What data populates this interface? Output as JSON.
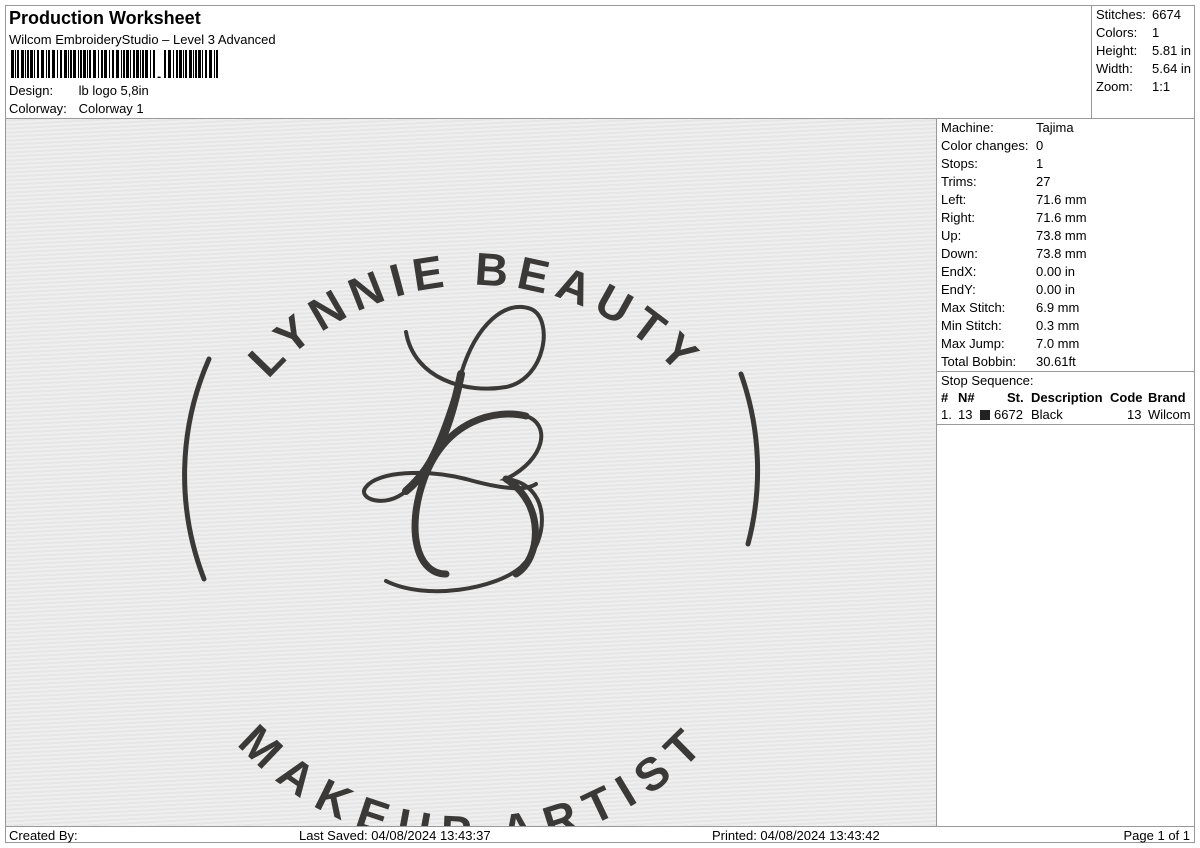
{
  "header": {
    "title": "Production Worksheet",
    "software": "Wilcom EmbroideryStudio – Level 3 Advanced",
    "design_label": "Design:",
    "design_value": "lb logo 5,8in",
    "colorway_label": "Colorway:",
    "colorway_value": "Colorway 1"
  },
  "summary": {
    "stitches_label": "Stitches:",
    "stitches_value": "6674",
    "colors_label": "Colors:",
    "colors_value": "1",
    "height_label": "Height:",
    "height_value": "5.81 in",
    "width_label": "Width:",
    "width_value": "5.64 in",
    "zoom_label": "Zoom:",
    "zoom_value": "1:1"
  },
  "design": {
    "top_text": "LYNNIE BEAUTY",
    "bottom_text": "MAKEUP ARTIST",
    "thread_color": "#3a3937"
  },
  "properties": [
    {
      "label": "Machine:",
      "value": "Tajima"
    },
    {
      "label": "Color changes:",
      "value": "0"
    },
    {
      "label": "Stops:",
      "value": "1"
    },
    {
      "label": "Trims:",
      "value": "27"
    },
    {
      "label": "Left:",
      "value": "71.6 mm"
    },
    {
      "label": "Right:",
      "value": "71.6 mm"
    },
    {
      "label": "Up:",
      "value": "73.8 mm"
    },
    {
      "label": "Down:",
      "value": "73.8 mm"
    },
    {
      "label": "EndX:",
      "value": "0.00 in"
    },
    {
      "label": "EndY:",
      "value": "0.00 in"
    },
    {
      "label": "Max Stitch:",
      "value": "6.9 mm"
    },
    {
      "label": "Min Stitch:",
      "value": "0.3 mm"
    },
    {
      "label": "Max Jump:",
      "value": "7.0 mm"
    },
    {
      "label": "Total Bobbin:",
      "value": "30.61ft"
    }
  ],
  "stop_sequence": {
    "title": "Stop Sequence:",
    "headers": {
      "index": "#",
      "n": "N#",
      "st": "St.",
      "description": "Description",
      "code": "Code",
      "brand": "Brand"
    },
    "rows": [
      {
        "index": "1.",
        "n": "13",
        "swatch": "#222222",
        "st": "6672",
        "description": "Black",
        "code": "13",
        "brand": "Wilcom"
      }
    ]
  },
  "footer": {
    "created_by": "Created By:",
    "last_saved": "Last Saved: 04/08/2024 13:43:37",
    "printed": "Printed: 04/08/2024 13:43:42",
    "page": "Page 1 of 1"
  }
}
